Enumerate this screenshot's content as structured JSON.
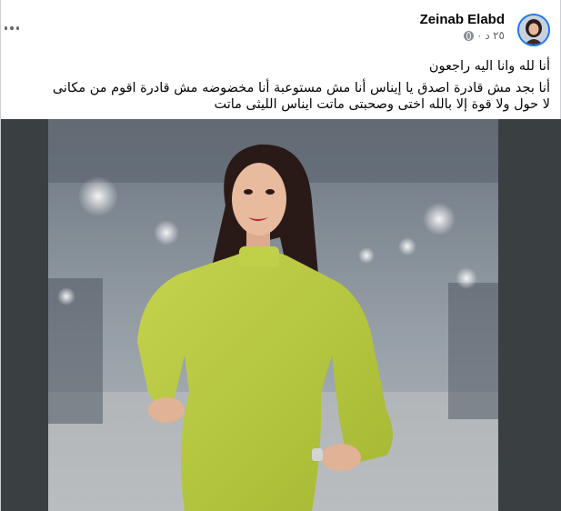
{
  "post": {
    "author": "Zeinab Elabd",
    "time": "٢٥ د",
    "privacy_icon": "globe-icon",
    "more_icon": "more-options-icon",
    "text_lines": [
      "أنا لله وانا اليه راجعون",
      "أنا بجد مش  قادرة  اصدق يا إيناس أنا مش مستوعبة أنا مخضوضه مش قادرة اقوم من مكانى",
      "لا حول ولا قوة إلا بالله اختى وصحبتى ماتت ايناس الليثى ماتت"
    ]
  },
  "colors": {
    "name": "#050505",
    "meta": "#65676b",
    "avatar_ring": "#1877f2",
    "dress": "#bfd145"
  }
}
